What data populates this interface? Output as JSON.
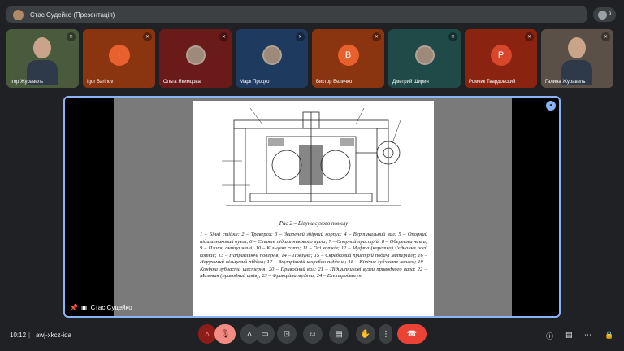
{
  "meeting": {
    "title": "Стас Судейко (Презентація)",
    "people_count": "9"
  },
  "tiles": [
    {
      "name": "Ігор Журавель",
      "kind": "video",
      "bg": "#4a5a3c"
    },
    {
      "name": "Igor Barinov",
      "kind": "letter",
      "letter": "I",
      "bg": "#8a3410",
      "circle": "#e8612c"
    },
    {
      "name": "Ольга Якимцова",
      "kind": "photo",
      "bg": "#6b1a1a"
    },
    {
      "name": "Марк Процко",
      "kind": "photo",
      "bg": "#1f3a5f"
    },
    {
      "name": "Виктор Величко",
      "kind": "letter",
      "letter": "B",
      "bg": "#8a3410",
      "circle": "#e8612c"
    },
    {
      "name": "Дмитрий Ширин",
      "kind": "photo",
      "bg": "#1f4a48"
    },
    {
      "name": "Ромчик Твардовский",
      "kind": "letter",
      "letter": "P",
      "bg": "#8a2410",
      "circle": "#d8462c"
    },
    {
      "name": "Галина Журавель",
      "kind": "video",
      "bg": "#5a5048"
    }
  ],
  "document": {
    "caption": "Рис 2 – Бігуни сухого помелу",
    "body": "1 – Бічні стійки; 2 – Траверса; 3 – Зварений збірний корпус; 4 – Вертикальний вал; 5 – Опорний підшипниковий вузол; 6 – Стакан підшипникового вузла; 7 – Опорний пристрій; 8 – Обертова чаша; 9 – Плити днища чаші; 10 – Кільцеве сито; 11 – Осі котків; 12 – Муфта (каретка) з'єднання осей котків; 13 – Направляючі повзунів; 14 – Повзуни; 15 – Скребковий пристрій подачі матеріалу; 16 – Нерухомий кільцевий піддон; 17 – Внутрішній шкребок піддона; 18 – Кінічне зубчасте колесо; 19 – Конічна зубчаста шестерня; 20 – Приводний вал; 21 – Підшипникові вузли приводного вала; 22 – Маховик (приводний шків); 23 – Фрикційна муфта; 24 – Електродвигун;"
  },
  "presenter": {
    "name": "Стас Судейко"
  },
  "bottom": {
    "time": "10:12",
    "separator": "|",
    "meeting_code": "awj-xkcz-ida"
  },
  "colors": {
    "accent": "#8ab4f8",
    "end_call": "#ea4335"
  }
}
